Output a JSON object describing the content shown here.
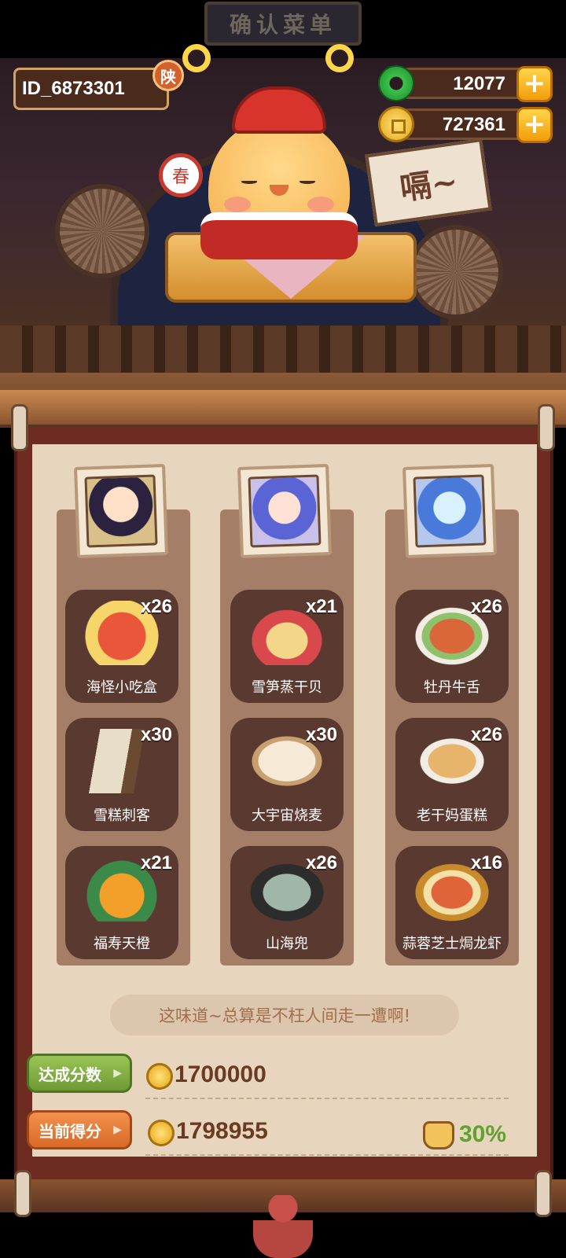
{
  "header": {
    "player_id": "ID_6873301",
    "region_badge": "陕",
    "sign_text": "确认菜单",
    "jade": {
      "value": "12077",
      "icon": "jade-coin-icon",
      "add_icon": "plus-icon"
    },
    "coins": {
      "value": "727361",
      "icon": "gold-coin-icon",
      "add_icon": "plus-icon"
    }
  },
  "scene": {
    "speech": "嗝~",
    "spring_badge": "春"
  },
  "customers": [
    {
      "name": "customer-1",
      "portrait_icon": "general-portrait-icon"
    },
    {
      "name": "customer-2",
      "portrait_icon": "blue-hair-portrait-icon"
    },
    {
      "name": "customer-3",
      "portrait_icon": "sunglasses-portrait-icon"
    }
  ],
  "dishes": [
    [
      {
        "label": "海怪小吃盒",
        "count": "x26",
        "color": "#e9563a"
      },
      {
        "label": "雪糕刺客",
        "count": "x30",
        "color": "#e8ddc8"
      },
      {
        "label": "福寿天橙",
        "count": "x21",
        "color": "#f2a02a"
      }
    ],
    [
      {
        "label": "雪笋蒸干贝",
        "count": "x21",
        "color": "#f4d68a"
      },
      {
        "label": "大宇宙烧麦",
        "count": "x30",
        "color": "#f6ead6"
      },
      {
        "label": "山海兜",
        "count": "x26",
        "color": "#9fb6a8"
      }
    ],
    [
      {
        "label": "牡丹牛舌",
        "count": "x26",
        "color": "#d9673a"
      },
      {
        "label": "老干妈蛋糕",
        "count": "x26",
        "color": "#e6b46a"
      },
      {
        "label": "蒜蓉芝士焗龙虾",
        "count": "x16",
        "color": "#e0643a"
      }
    ]
  ],
  "quote": "这味道~总算是不枉人间走一遭啊!",
  "scores": {
    "target_label": "达成分数",
    "target_value": "1700000",
    "current_label": "当前得分",
    "current_value": "1798955",
    "bonus": "30%"
  },
  "colors": {
    "paper": "#e7d5bd",
    "frame": "#6d2b22",
    "card": "#5a3a30",
    "bonus_green": "#5fa22f"
  }
}
